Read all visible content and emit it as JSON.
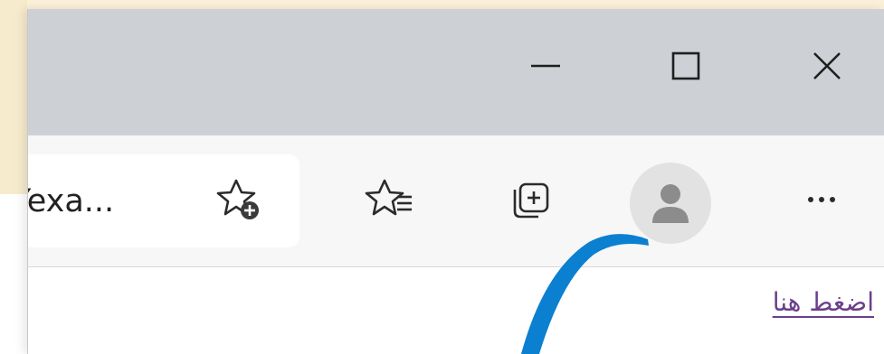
{
  "window_controls": {
    "minimize_icon": "minimize-icon",
    "maximize_icon": "maximize-icon",
    "close_icon": "close-icon"
  },
  "toolbar": {
    "address_text": "Yexa...",
    "icons": [
      "add-favorite-icon",
      "favorites-icon",
      "collections-icon",
      "profile-icon",
      "more-icon"
    ],
    "more_label": "···"
  },
  "content": {
    "link_text": "اضغط هنا"
  },
  "colors": {
    "titlebar": "#cdd0d4",
    "toolbar": "#f7f7f7",
    "link": "#6b3f8c",
    "annotation_arrow": "#0b7fd0",
    "page_background": "#fbf0d8"
  }
}
